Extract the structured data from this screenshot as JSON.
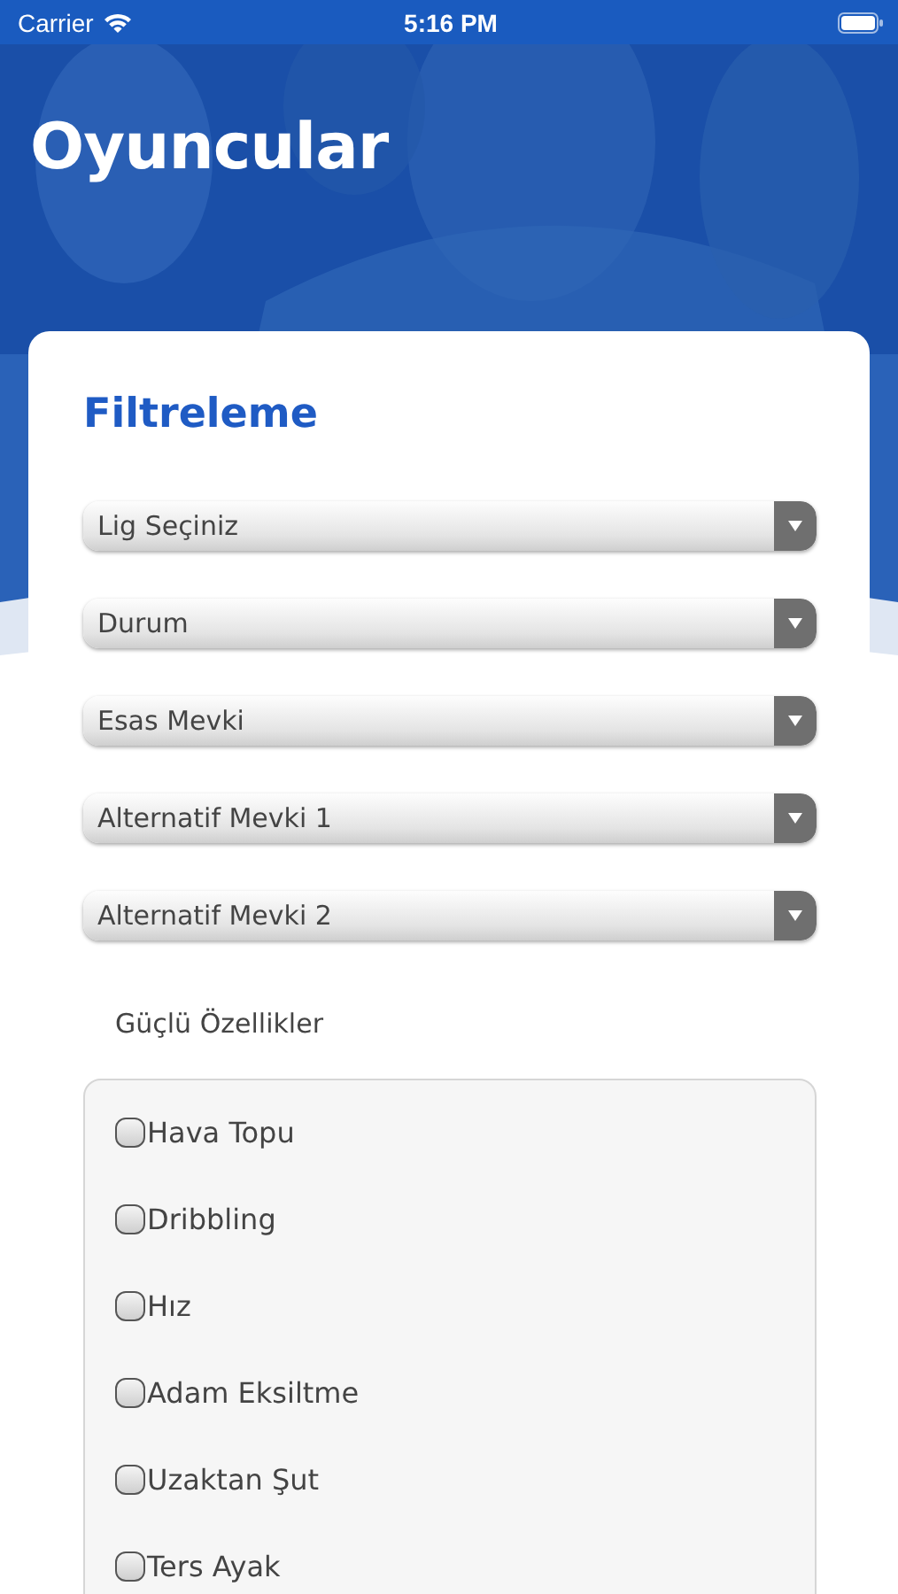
{
  "status_bar": {
    "carrier": "Carrier",
    "time": "5:16 PM"
  },
  "header": {
    "title": "Oyuncular"
  },
  "filter": {
    "title": "Filtreleme",
    "dropdowns": [
      {
        "label": "Lig Seçiniz"
      },
      {
        "label": "Durum"
      },
      {
        "label": "Esas Mevki"
      },
      {
        "label": "Alternatif Mevki 1"
      },
      {
        "label": "Alternatif Mevki 2"
      }
    ],
    "strengths": {
      "label": "Güçlü Özellikler",
      "options": [
        {
          "label": "Hava Topu",
          "checked": false
        },
        {
          "label": "Dribbling",
          "checked": false
        },
        {
          "label": "Hız",
          "checked": false
        },
        {
          "label": "Adam Eksiltme",
          "checked": false
        },
        {
          "label": "Uzaktan Şut",
          "checked": false
        },
        {
          "label": "Ters Ayak",
          "checked": false
        }
      ]
    }
  }
}
